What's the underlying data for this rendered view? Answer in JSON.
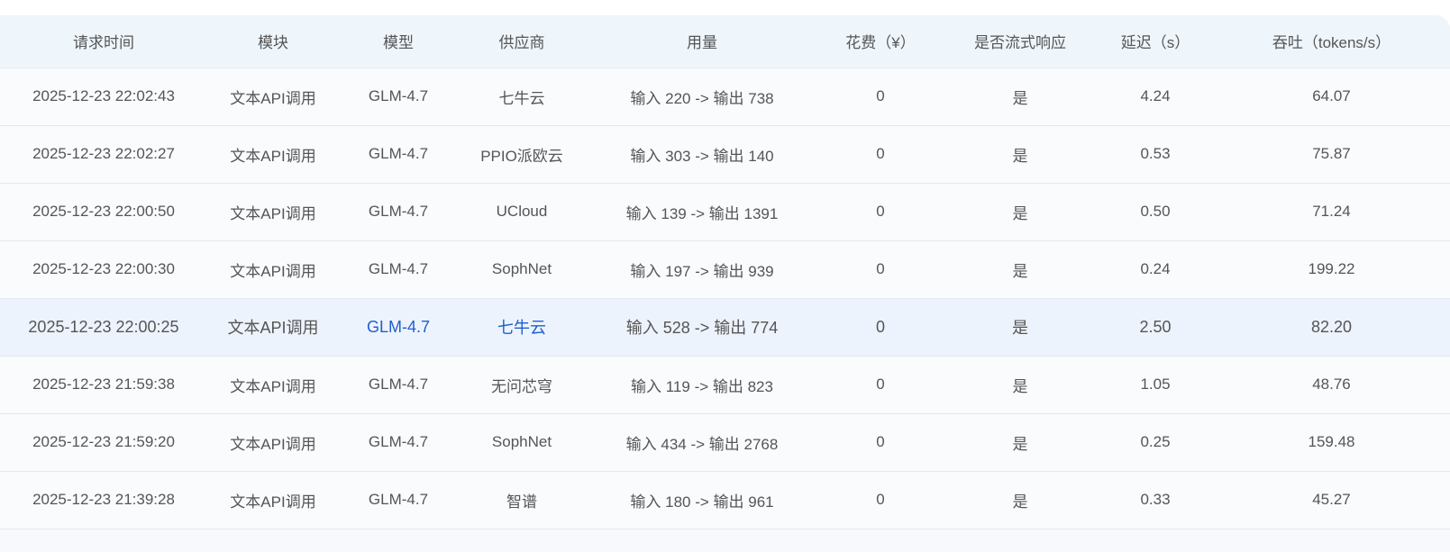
{
  "table": {
    "headers": [
      "请求时间",
      "模块",
      "模型",
      "供应商",
      "用量",
      "花费（¥）",
      "是否流式响应",
      "延迟（s）",
      "吞吐（tokens/s）"
    ],
    "rows": [
      {
        "time": "2025-12-23 22:02:43",
        "module": "文本API调用",
        "model": "GLM-4.7",
        "provider": "七牛云",
        "usage": "输入 220 -> 输出 738",
        "cost": "0",
        "stream": "是",
        "latency": "4.24",
        "throughput": "64.07"
      },
      {
        "time": "2025-12-23 22:02:27",
        "module": "文本API调用",
        "model": "GLM-4.7",
        "provider": "PPIO派欧云",
        "usage": "输入 303 -> 输出 140",
        "cost": "0",
        "stream": "是",
        "latency": "0.53",
        "throughput": "75.87"
      },
      {
        "time": "2025-12-23 22:00:50",
        "module": "文本API调用",
        "model": "GLM-4.7",
        "provider": "UCloud",
        "usage": "输入 139 -> 输出 1391",
        "cost": "0",
        "stream": "是",
        "latency": "0.50",
        "throughput": "71.24"
      },
      {
        "time": "2025-12-23 22:00:30",
        "module": "文本API调用",
        "model": "GLM-4.7",
        "provider": "SophNet",
        "usage": "输入 197 -> 输出 939",
        "cost": "0",
        "stream": "是",
        "latency": "0.24",
        "throughput": "199.22"
      },
      {
        "time": "2025-12-23 22:00:25",
        "module": "文本API调用",
        "model": "GLM-4.7",
        "provider": "七牛云",
        "usage": "输入 528 -> 输出 774",
        "cost": "0",
        "stream": "是",
        "latency": "2.50",
        "throughput": "82.20"
      },
      {
        "time": "2025-12-23 21:59:38",
        "module": "文本API调用",
        "model": "GLM-4.7",
        "provider": "无问芯穹",
        "usage": "输入 119 -> 输出 823",
        "cost": "0",
        "stream": "是",
        "latency": "1.05",
        "throughput": "48.76"
      },
      {
        "time": "2025-12-23 21:59:20",
        "module": "文本API调用",
        "model": "GLM-4.7",
        "provider": "SophNet",
        "usage": "输入 434 -> 输出 2768",
        "cost": "0",
        "stream": "是",
        "latency": "0.25",
        "throughput": "159.48"
      },
      {
        "time": "2025-12-23 21:39:28",
        "module": "文本API调用",
        "model": "GLM-4.7",
        "provider": "智谱",
        "usage": "输入 180 -> 输出 961",
        "cost": "0",
        "stream": "是",
        "latency": "0.33",
        "throughput": "45.27"
      }
    ],
    "hovered_row": 4
  },
  "colors": {
    "header_bg": "#eef5fb",
    "row_bg": "#f9fbfd",
    "hover_bg": "#edf3fc",
    "link": "#1f5fd1",
    "text": "#555555"
  }
}
